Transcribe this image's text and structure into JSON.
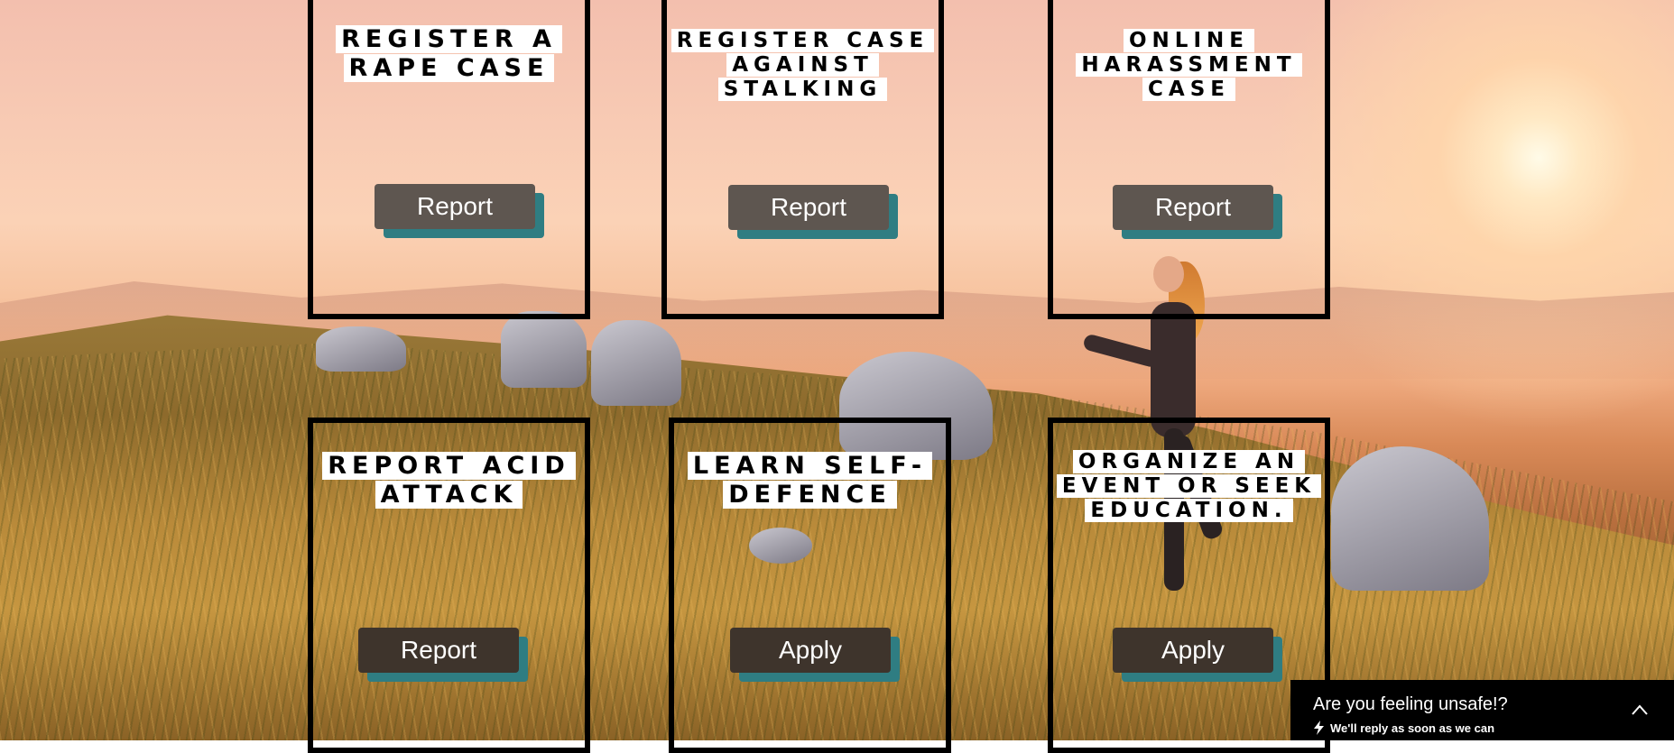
{
  "cards": [
    {
      "title": "REGISTER A\nRAPE CASE",
      "button": "Report"
    },
    {
      "title": "REGISTER CASE\nAGAINST\nSTALKING",
      "button": "Report"
    },
    {
      "title": "ONLINE\nHARASSMENT\nCASE",
      "button": "Report"
    },
    {
      "title": "REPORT ACID\nATTACK",
      "button": "Report"
    },
    {
      "title": "LEARN SELF-\nDEFENCE",
      "button": "Apply"
    },
    {
      "title": "ORGANIZE AN\nEVENT OR SEEK\nEDUCATION.",
      "button": "Apply"
    }
  ],
  "chat": {
    "title": "Are you feeling unsafe!?",
    "subtitle": "We'll reply as soon as we can",
    "icons": [
      "lightning-icon",
      "chevron-up-icon"
    ]
  },
  "colors": {
    "button_bg": "#5e5650",
    "button_shadow": "#2f7d82",
    "card_border": "#000000",
    "chat_bg": "#000000"
  }
}
